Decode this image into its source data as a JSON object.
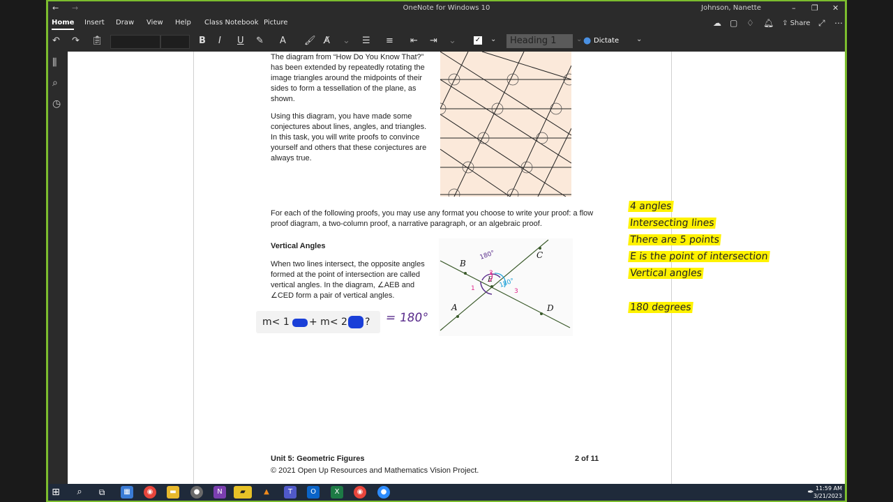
{
  "window": {
    "title": "OneNote for Windows 10",
    "user": "Johnson, Nanette"
  },
  "menu": {
    "tabs": [
      "Home",
      "Insert",
      "Draw",
      "View",
      "Help",
      "Class Notebook",
      "Picture"
    ],
    "share_label": "Share"
  },
  "toolbar": {
    "style_value": "Heading 1",
    "dictate_label": "Dictate"
  },
  "document": {
    "intro_p1": [
      "The diagram from “How Do You Know That?”",
      "has been extended by repeatedly rotating the",
      "image triangles around the midpoints of their",
      "sides to form a tessellation of the plane, as",
      "shown."
    ],
    "intro_p2": [
      "Using this diagram, you have made some",
      "conjectures about lines, angles, and triangles.",
      "In this task, you will write proofs to convince",
      "yourself and others that these conjectures are",
      "always true."
    ],
    "proof_intro": [
      "For each of the following proofs, you may use any format you choose to write your proof: a flow",
      "proof diagram, a two-column proof, a narrative paragraph, or an algebraic proof."
    ],
    "section_title": "Vertical Angles",
    "section_text": [
      "When two lines intersect, the opposite angles",
      "formed at the point of intersection are called",
      "vertical angles. In the diagram, ∠AEB and",
      "∠CED form a pair of vertical angles."
    ],
    "diagram_labels": {
      "A": "A",
      "B": "B",
      "C": "C",
      "D": "D",
      "E": "E"
    },
    "footer_unit": "Unit 5: Geometric Figures",
    "footer_page": "2 of 11",
    "footer_copyright": "© 2021 Open Up Resources and Mathematics Vision Project."
  },
  "handwriting": {
    "equation_left": "m< 1",
    "equation_plus": "+ m< 2",
    "equation_q": "?",
    "equation_result": "= 180°",
    "annot_angle1": "1",
    "annot_angle2": "2",
    "annot_angle3": "3",
    "annot_180a": "180°",
    "annot_180b": "180°",
    "notes": [
      "4 angles",
      "Intersecting lines",
      "There are 5 points",
      "E is the point of intersection",
      "Vertical angles",
      "180 degrees"
    ]
  },
  "taskbar": {
    "time": "11:59 AM",
    "date": "3/21/2023"
  },
  "colors": {
    "frame": "#7cbd2e",
    "chrome": "#2b2b2b",
    "highlight": "#fff200",
    "tessellation_bg": "#fbe9da",
    "ink_pink": "#e0248a",
    "ink_blue": "#1aa0d8",
    "ink_purple": "#5a2d8c"
  }
}
